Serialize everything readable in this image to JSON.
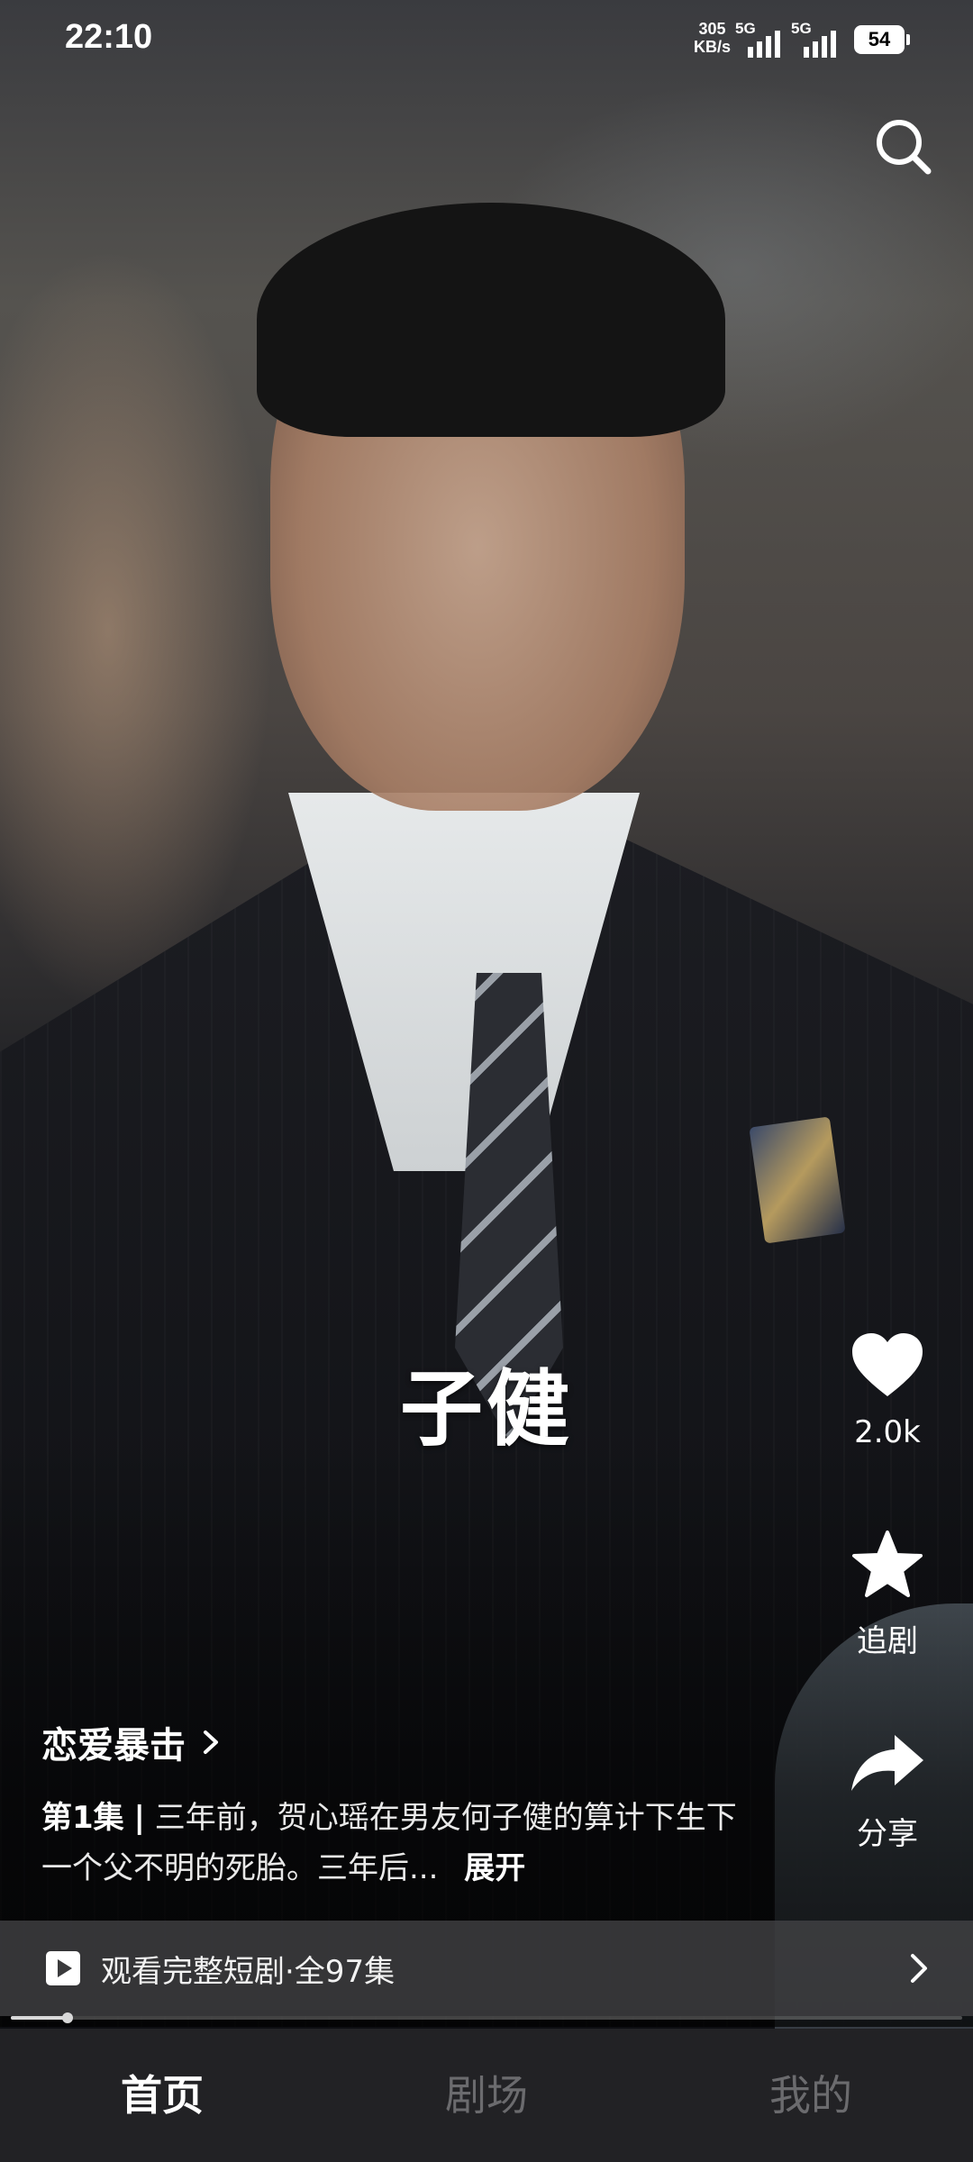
{
  "status_bar": {
    "time": "22:10",
    "net_speed_value": "305",
    "net_speed_unit": "KB/s",
    "signal_1_label": "5G",
    "signal_2_label": "5G",
    "battery": "54"
  },
  "video": {
    "subtitle": "子健"
  },
  "actions": {
    "like_count": "2.0k",
    "follow_label": "追剧",
    "share_label": "分享"
  },
  "drama": {
    "title": "恋爱暴击",
    "episode": "第1集",
    "separator": "|",
    "description": "三年前，贺心瑶在男友何子健的算计下生下一个父不明的死胎。三年后...",
    "expand_label": "展开"
  },
  "full_bar": {
    "label": "观看完整短剧·全97集"
  },
  "playback": {
    "progress": 0.06
  },
  "bottom_nav": {
    "tabs": [
      "首页",
      "剧场",
      "我的"
    ],
    "active_index": 0
  },
  "icons": {
    "search": "search-icon",
    "like": "heart-icon",
    "follow": "star-icon",
    "share": "share-arrow-icon",
    "play": "play-icon",
    "chevron": "chevron-right-icon"
  }
}
